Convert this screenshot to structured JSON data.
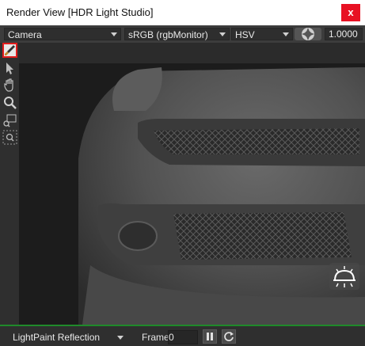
{
  "window": {
    "title": "Render View [HDR Light Studio]",
    "close_label": "x"
  },
  "toolbar": {
    "camera": "Camera",
    "colorspace": "sRGB (rgbMonitor)",
    "colormode": "HSV",
    "zoom_value": "1.0000"
  },
  "tools": [
    {
      "name": "paint-brush-icon",
      "selected": true
    },
    {
      "name": "pointer-arrow-icon",
      "selected": false
    },
    {
      "name": "hand-pan-icon",
      "selected": false
    },
    {
      "name": "magnifier-zoom-icon",
      "selected": false
    },
    {
      "name": "zoom-region-icon",
      "selected": false
    },
    {
      "name": "zoom-fit-icon",
      "selected": false
    }
  ],
  "viewport": {
    "subject": "car front grille",
    "overlay_icon": "light-dome-icon"
  },
  "bottom": {
    "mode": "LightPaint Reflection",
    "frame_label": "Frame",
    "frame_value": "0"
  },
  "colors": {
    "accent_green": "#1f8a2a",
    "selection_red": "#e01c1c",
    "close_red": "#e81123"
  }
}
